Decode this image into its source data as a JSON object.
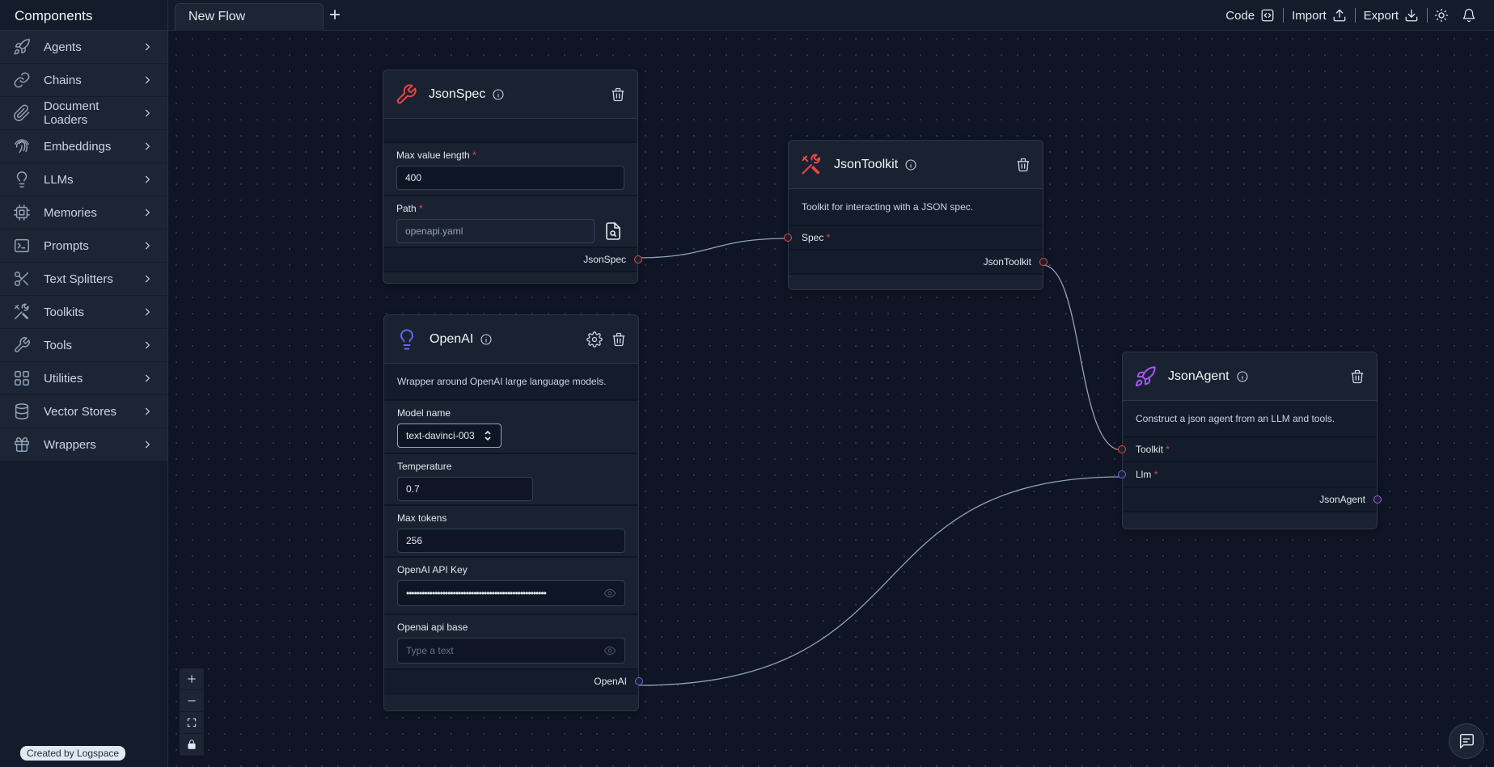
{
  "sidebar": {
    "title": "Components",
    "items": [
      {
        "label": "Agents",
        "icon": "rocket-icon"
      },
      {
        "label": "Chains",
        "icon": "link-icon"
      },
      {
        "label": "Document Loaders",
        "icon": "paperclip-icon"
      },
      {
        "label": "Embeddings",
        "icon": "fingerprint-icon"
      },
      {
        "label": "LLMs",
        "icon": "lightbulb-icon"
      },
      {
        "label": "Memories",
        "icon": "cpu-icon"
      },
      {
        "label": "Prompts",
        "icon": "terminal-icon"
      },
      {
        "label": "Text Splitters",
        "icon": "scissors-icon"
      },
      {
        "label": "Toolkits",
        "icon": "tools-icon"
      },
      {
        "label": "Tools",
        "icon": "wrench-icon"
      },
      {
        "label": "Utilities",
        "icon": "grid-icon"
      },
      {
        "label": "Vector Stores",
        "icon": "database-icon"
      },
      {
        "label": "Wrappers",
        "icon": "gift-icon"
      }
    ],
    "credit": "Created by Logspace"
  },
  "topbar": {
    "tab_label": "New Flow",
    "code_label": "Code",
    "import_label": "Import",
    "export_label": "Export"
  },
  "nodes": {
    "jsonspec": {
      "title": "JsonSpec",
      "max_value_length_label": "Max value length",
      "max_value_length_value": "400",
      "path_label": "Path",
      "path_value": "openapi.yaml",
      "output_label": "JsonSpec",
      "icon_color": "#ef4444"
    },
    "jsontoolkit": {
      "title": "JsonToolkit",
      "description": "Toolkit for interacting with a JSON spec.",
      "spec_label": "Spec",
      "output_label": "JsonToolkit",
      "icon_color": "#ef4444"
    },
    "openai": {
      "title": "OpenAI",
      "description": "Wrapper around OpenAI large language models.",
      "model_name_label": "Model name",
      "model_name_value": "text-davinci-003",
      "temperature_label": "Temperature",
      "temperature_value": "0.7",
      "max_tokens_label": "Max tokens",
      "max_tokens_value": "256",
      "api_key_label": "OpenAI API Key",
      "api_key_value": "••••••••••••••••••••••••••••••••••••••••••••••••••••••",
      "api_base_label": "Openai api base",
      "api_base_placeholder": "Type a text",
      "output_label": "OpenAI",
      "icon_color": "#6366f1"
    },
    "jsonagent": {
      "title": "JsonAgent",
      "description": "Construct a json agent from an LLM and tools.",
      "toolkit_label": "Toolkit",
      "llm_label": "Llm",
      "output_label": "JsonAgent",
      "icon_color": "#a855f7"
    }
  },
  "required_marker": "*",
  "colors": {
    "red_handle": "#ef4444",
    "blue_handle": "#6366f1",
    "purple_handle": "#a855f7"
  }
}
